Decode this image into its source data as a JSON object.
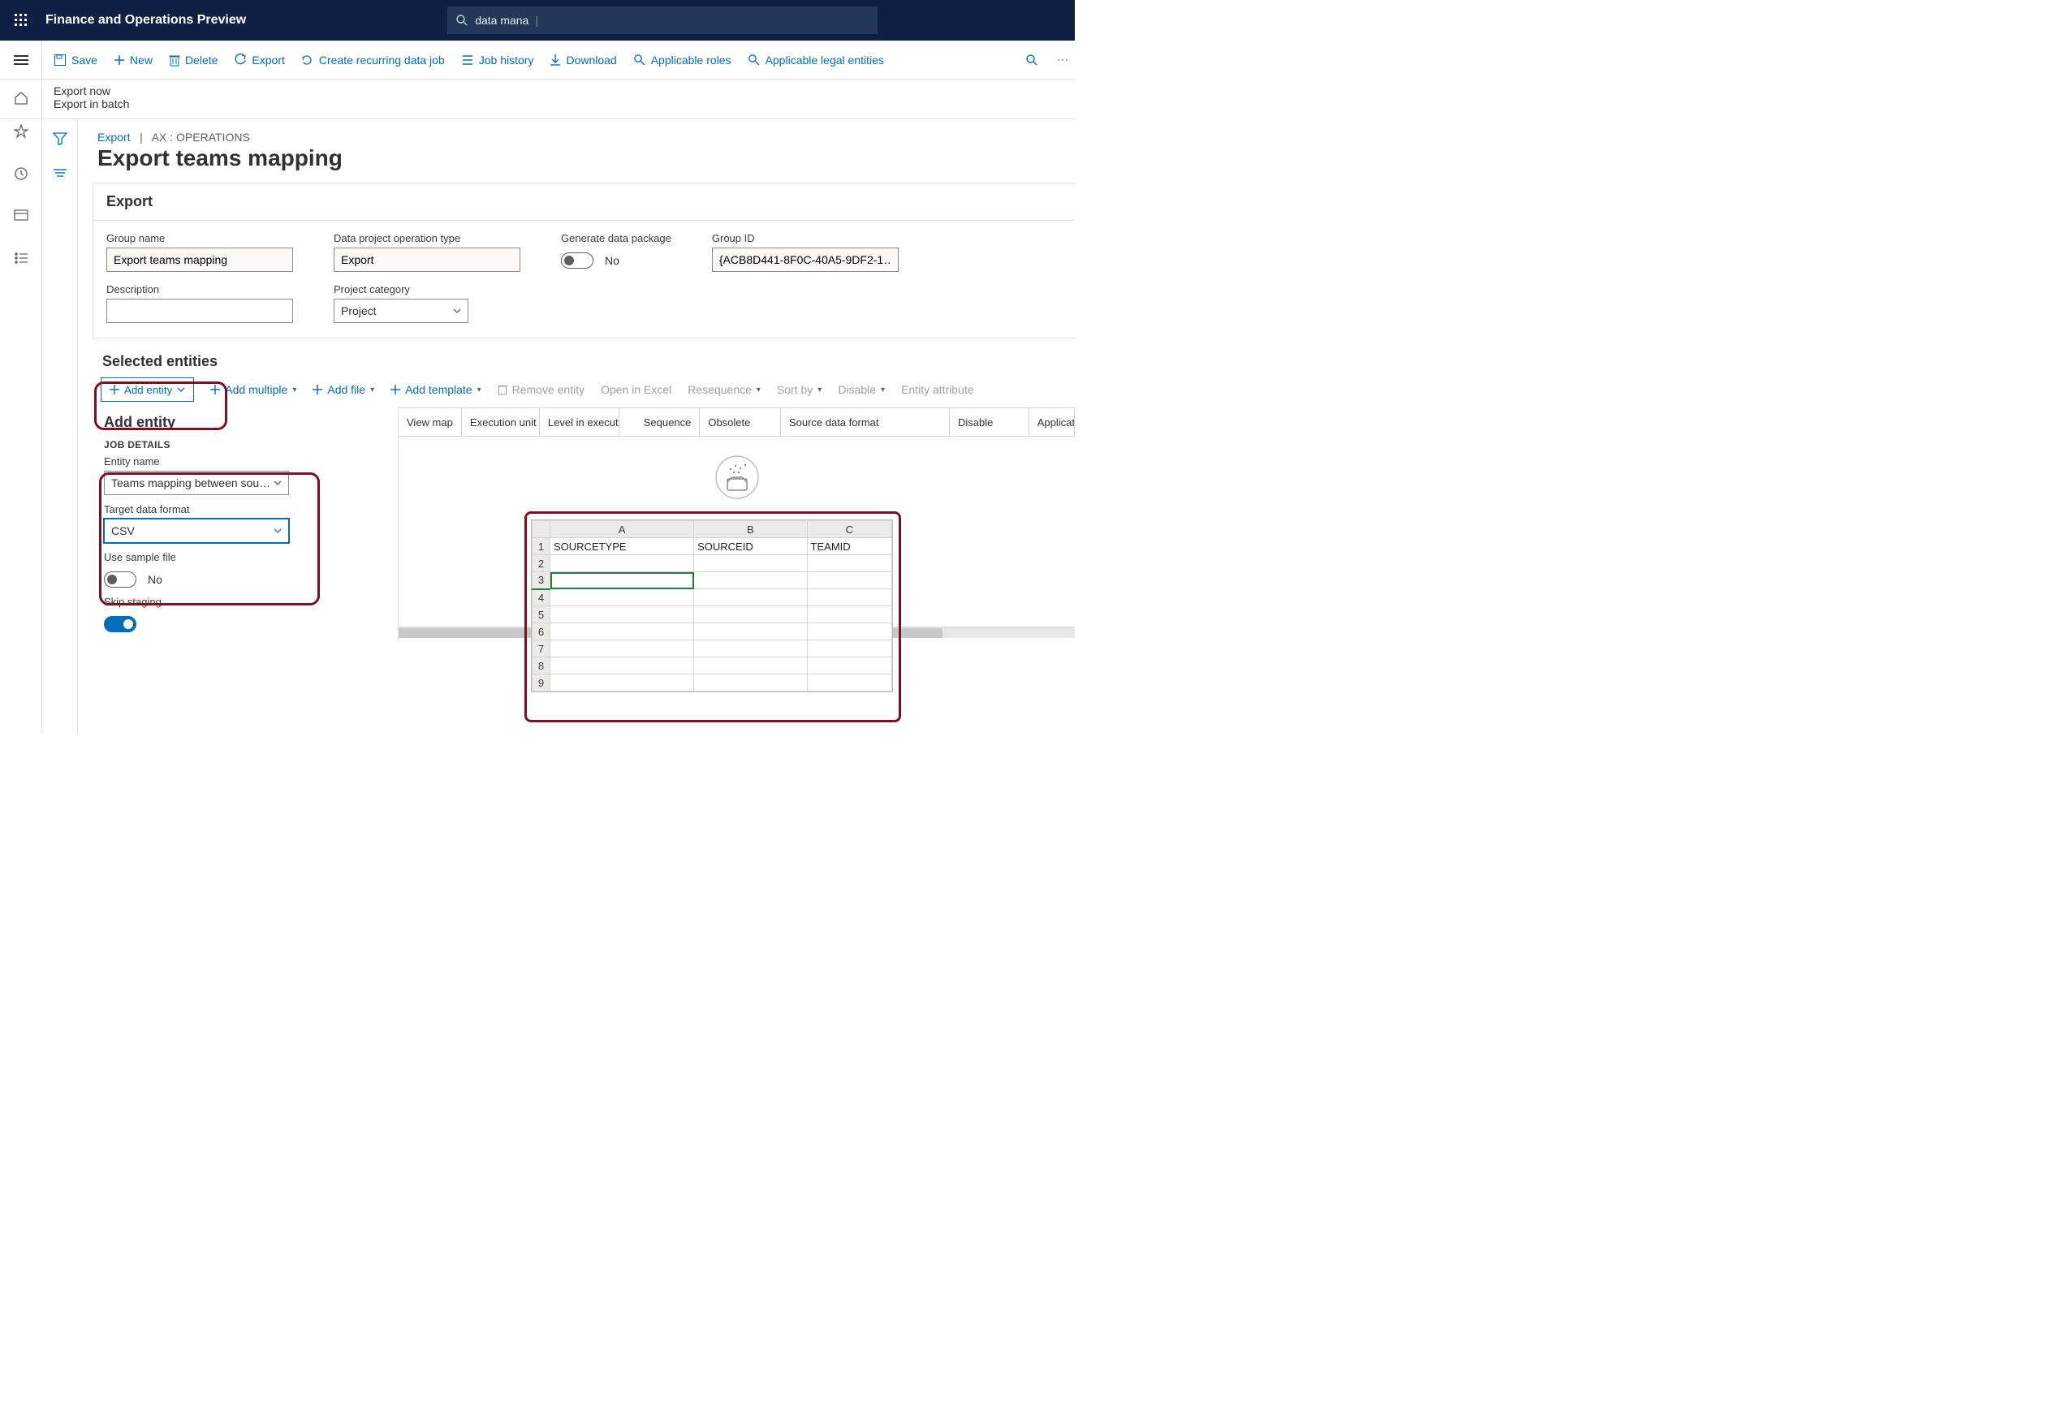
{
  "header": {
    "app_title": "Finance and Operations Preview",
    "search_text": "data mana"
  },
  "toolbar": {
    "save": "Save",
    "new": "New",
    "delete": "Delete",
    "export": "Export",
    "recurring": "Create recurring data job",
    "history": "Job history",
    "download": "Download",
    "roles": "Applicable roles",
    "entities": "Applicable legal entities"
  },
  "subheader": {
    "export_now": "Export now",
    "export_batch": "Export in batch"
  },
  "breadcrumb": {
    "link": "Export",
    "context": "AX : OPERATIONS",
    "sep": "|"
  },
  "page_title": "Export teams mapping",
  "export_card": {
    "title": "Export",
    "group_name_label": "Group name",
    "group_name": "Export teams mapping",
    "op_type_label": "Data project operation type",
    "op_type": "Export",
    "generate_label": "Generate data package",
    "generate_value": "No",
    "group_id_label": "Group ID",
    "group_id": "{ACB8D441-8F0C-40A5-9DF2-1…",
    "desc_label": "Description",
    "desc": "",
    "proj_cat_label": "Project category",
    "proj_cat": "Project"
  },
  "selected_entities_title": "Selected entities",
  "entity_toolbar": {
    "add_entity": "Add entity",
    "add_multiple": "Add multiple",
    "add_file": "Add file",
    "add_template": "Add template",
    "remove": "Remove entity",
    "open_excel": "Open in Excel",
    "resequence": "Resequence",
    "sort_by": "Sort by",
    "disable": "Disable",
    "entity_attr": "Entity attribute"
  },
  "grid_columns": {
    "viewmap": "View map",
    "exec": "Execution unit",
    "level": "Level in executi…",
    "seq": "Sequence",
    "obs": "Obsolete",
    "sdf": "Source data format",
    "dis": "Disable",
    "appl": "Applicat"
  },
  "add_entity_panel": {
    "title": "Add entity",
    "job_details": "JOB DETAILS",
    "entity_name_label": "Entity name",
    "entity_name": "Teams mapping between sou…",
    "target_format_label": "Target data format",
    "target_format": "CSV",
    "use_sample_label": "Use sample file",
    "use_sample_value": "No",
    "skip_staging_label": "Skip staging"
  },
  "excel": {
    "columns": [
      "A",
      "B",
      "C"
    ],
    "headers": [
      "SOURCETYPE",
      "SOURCEID",
      "TEAMID"
    ],
    "rows": [
      1,
      2,
      3,
      4,
      5,
      6,
      7,
      8,
      9
    ]
  }
}
